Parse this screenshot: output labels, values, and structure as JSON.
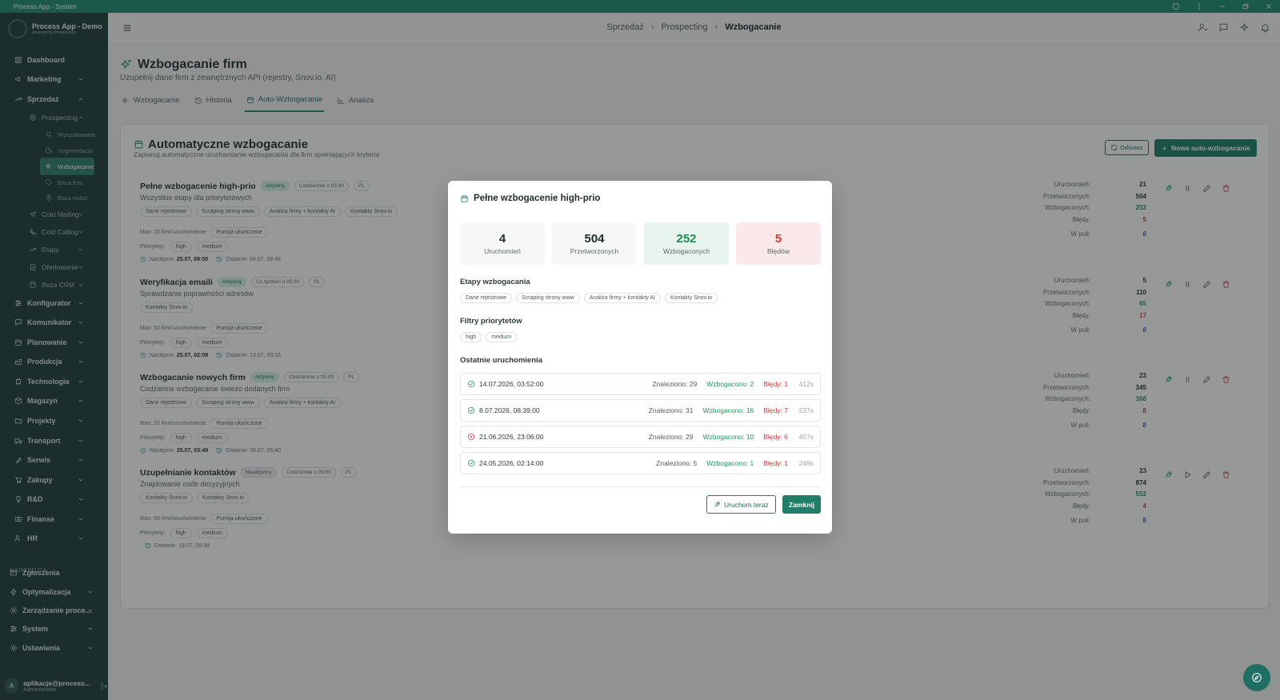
{
  "window": {
    "title": "Process App - System"
  },
  "brand": {
    "name": "Process App - Demo",
    "tagline": "powered by Process App"
  },
  "sidebar": {
    "items": [
      {
        "label": "Dashboard"
      },
      {
        "label": "Marketing"
      },
      {
        "label": "Sprzedaż"
      },
      {
        "label": "Prospecting"
      },
      {
        "label": "Wyszukiwanie"
      },
      {
        "label": "Segmentacja"
      },
      {
        "label": "Wzbogacanie"
      },
      {
        "label": "Baza fraz"
      },
      {
        "label": "Baza miast"
      },
      {
        "label": "Cold Mailing"
      },
      {
        "label": "Cold Calling"
      },
      {
        "label": "Etapy"
      },
      {
        "label": "Ofertowanie"
      },
      {
        "label": "Baza CRM"
      },
      {
        "label": "Konfigurator"
      },
      {
        "label": "Komunikator"
      },
      {
        "label": "Planowanie"
      },
      {
        "label": "Produkcja"
      },
      {
        "label": "Technologia"
      },
      {
        "label": "Magazyn"
      },
      {
        "label": "Projekty"
      },
      {
        "label": "Transport"
      },
      {
        "label": "Serwis"
      },
      {
        "label": "Zakupy"
      },
      {
        "label": "R&D"
      },
      {
        "label": "Finanse"
      },
      {
        "label": "HR"
      }
    ],
    "tools_label": "NARZĘDZIA",
    "tools": [
      {
        "label": "Zgłoszenia"
      },
      {
        "label": "Optymalizacja"
      },
      {
        "label": "Zarządzanie proce..."
      },
      {
        "label": "System"
      },
      {
        "label": "Ustawienia"
      }
    ],
    "user": {
      "initial": "A",
      "email": "aplikacje@process...",
      "role": "Administrator"
    }
  },
  "header": {
    "crumbs": [
      "Sprzedaż",
      "Prospecting",
      "Wzbogacanie"
    ]
  },
  "page": {
    "title": "Wzbogacanie firm",
    "subtitle": "Uzupełnij dane firm z zewnętrznych API (rejestry, Snov.io, AI)",
    "tabs": [
      {
        "label": "Wzbogacanie"
      },
      {
        "label": "Historia"
      },
      {
        "label": "Auto-Wzbogacanie"
      },
      {
        "label": "Analiza"
      }
    ]
  },
  "card": {
    "title": "Automatyczne wzbogacanie",
    "subtitle": "Zaplanuj automatyczne uruchamianie wzbogacania dla firm spełniających kryteria",
    "refresh": "Odśwież",
    "new": "Nowe auto-wzbogacanie"
  },
  "jobs": [
    {
      "name": "Pełne wzbogacenie high-prio",
      "status": "Aktywny",
      "schedule": "Codziennie o 05:00",
      "lang": "PL",
      "desc": "Wszystkie etapy dla priorytetowych",
      "steps": [
        "Dane rejestrowe",
        "Scraping strony www",
        "Analiza firmy + kontakty AI",
        "Kontakty Snov.io"
      ],
      "max": "Max: 20 firm/uruchomienie",
      "skip": "Pomija ukończone",
      "prio_label": "Priorytety:",
      "prios": [
        "high",
        "medium"
      ],
      "next_label": "Następne:",
      "next": "25.07, 09:50",
      "last": "Ostatnie: 04.07, 08:48",
      "stats": {
        "runs": "21",
        "processed": "504",
        "enriched": "252",
        "errors": "5",
        "pool": "8"
      }
    },
    {
      "name": "Weryfikacja emaili",
      "status": "Aktywny",
      "schedule": "Co tydzień o 05:00",
      "lang": "PL",
      "desc": "Sprawdzanie poprawności adresów",
      "steps": [
        "Kontakty Snov.io"
      ],
      "max": "Max: 50 firm/uruchomienie",
      "skip": "Pomija ukończone",
      "prio_label": "Priorytety:",
      "prios": [
        "high",
        "medium"
      ],
      "next_label": "Następne:",
      "next": "25.07, 02:09",
      "last": "Ostatnie: 13.07, 00:15",
      "stats": {
        "runs": "5",
        "processed": "110",
        "enriched": "65",
        "errors": "17",
        "pool": "8"
      }
    },
    {
      "name": "Wzbogacanie nowych firm",
      "status": "Aktywny",
      "schedule": "Codziennie o 05:00",
      "lang": "PL",
      "desc": "Codzienne wzbogacanie świeżo dodanych firm",
      "steps": [
        "Dane rejestrowe",
        "Scraping strony www",
        "Analiza firmy + kontakty AI"
      ],
      "max": "Max: 20 firm/uruchomienie",
      "skip": "Pomija ukończone",
      "prio_label": "Priorytety:",
      "prios": [
        "high",
        "medium"
      ],
      "next_label": "Następne:",
      "next": "25.07, 03:49",
      "last": "Ostatnie: 09.07, 06:40",
      "stats": {
        "runs": "23",
        "processed": "345",
        "enriched": "368",
        "errors": "8",
        "pool": "8"
      }
    },
    {
      "name": "Uzupełnianie kontaktów",
      "status": "Nieaktywny",
      "schedule": "Codziennie o 05:00",
      "lang": "PL",
      "desc": "Znajdowanie osób decyzyjnych",
      "steps": [
        "Kontakty Snov.io",
        "Kontakty Snov.io"
      ],
      "max": "Max: 50 firm/uruchomienie",
      "skip": "Pomija ukończone",
      "prio_label": "Priorytety:",
      "prios": [
        "high",
        "medium"
      ],
      "next_label": "",
      "next": "",
      "last": "Ostatnie: 19.07, 09:38",
      "stats": {
        "runs": "23",
        "processed": "874",
        "enriched": "552",
        "errors": "4",
        "pool": "8"
      }
    }
  ],
  "stat_labels": {
    "runs": "Uruchomień:",
    "processed": "Przetworzonych:",
    "enriched": "Wzbogaconych:",
    "errors": "Błędy:",
    "pool": "W puli:"
  },
  "modal": {
    "title": "Pełne wzbogacenie high-prio",
    "kpis": [
      {
        "value": "4",
        "label": "Uruchomień"
      },
      {
        "value": "504",
        "label": "Przetworzonych"
      },
      {
        "value": "252",
        "label": "Wzbogaconych"
      },
      {
        "value": "5",
        "label": "Błędów"
      }
    ],
    "steps_title": "Etapy wzbogacania",
    "steps": [
      "Dane rejestrowe",
      "Scraping strony www",
      "Analiza firmy + kontakty AI",
      "Kontakty Snov.io"
    ],
    "prio_title": "Filtry priorytetów",
    "prios": [
      "high",
      "medium"
    ],
    "runs_title": "Ostatnie uruchomienia",
    "runs": [
      {
        "date": "14.07.2026, 03:52:00",
        "status": "ok",
        "found": "Znaleziono: 29",
        "enriched": "Wzbogacono: 2",
        "errors": "Błędy: 1",
        "time": "412s"
      },
      {
        "date": "8.07.2026, 08:39:00",
        "status": "ok",
        "found": "Znaleziono: 31",
        "enriched": "Wzbogacono: 16",
        "errors": "Błędy: 7",
        "time": "237s"
      },
      {
        "date": "21.06.2026, 23:06:00",
        "status": "error",
        "found": "Znaleziono: 29",
        "enriched": "Wzbogacono: 10",
        "errors": "Błędy: 6",
        "time": "457s"
      },
      {
        "date": "24.05.2026, 02:14:00",
        "status": "ok",
        "found": "Znaleziono: 5",
        "enriched": "Wzbogacono: 1",
        "errors": "Błędy: 1",
        "time": "249s"
      }
    ],
    "run_now": "Uruchom teraz",
    "close": "Zamknij"
  },
  "colors": {
    "accent": "#1e8b72",
    "sidebar": "#1f3c3a",
    "success": "#1e9a5c",
    "danger": "#d03a3a",
    "pool": "#2a5fd0"
  }
}
